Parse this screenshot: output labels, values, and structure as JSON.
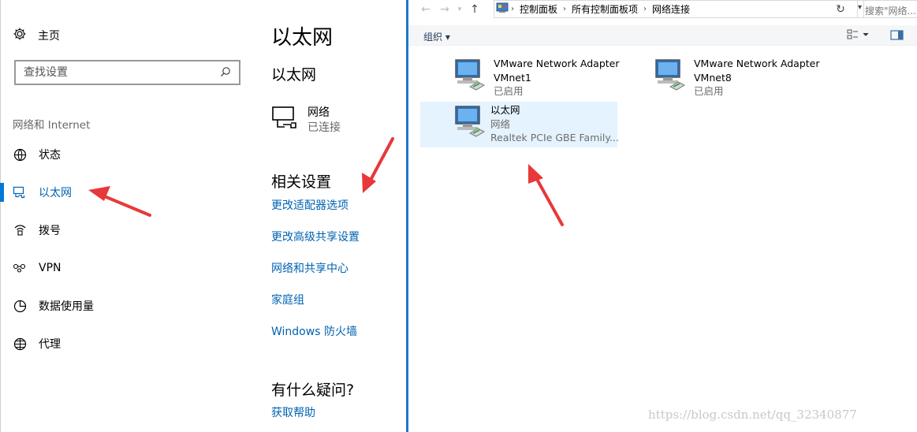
{
  "settings": {
    "home_label": "主页",
    "search_placeholder": "查找设置",
    "section_title": "网络和 Internet",
    "nav": [
      {
        "label": "状态",
        "icon": "globe-status-icon"
      },
      {
        "label": "以太网",
        "icon": "ethernet-icon",
        "active": true
      },
      {
        "label": "拨号",
        "icon": "dialup-icon"
      },
      {
        "label": "VPN",
        "icon": "vpn-icon"
      },
      {
        "label": "数据使用量",
        "icon": "data-usage-icon"
      },
      {
        "label": "代理",
        "icon": "proxy-globe-icon"
      }
    ],
    "content": {
      "title": "以太网",
      "subtitle": "以太网",
      "network_name": "网络",
      "network_status": "已连接",
      "related_title": "相关设置",
      "links": [
        "更改适配器选项",
        "更改高级共享设置",
        "网络和共享中心",
        "家庭组",
        "Windows 防火墙"
      ],
      "question_title": "有什么疑问?",
      "help_link": "获取帮助"
    }
  },
  "explorer": {
    "breadcrumb": [
      "控制面板",
      "所有控制面板项",
      "网络连接"
    ],
    "search_placeholder": "搜索\"网络...",
    "organize_label": "组织 ▾",
    "adapters": [
      {
        "name": "VMware Network Adapter",
        "line2": "VMnet1",
        "line3": "已启用"
      },
      {
        "name": "VMware Network Adapter",
        "line2": "VMnet8",
        "line3": "已启用"
      },
      {
        "name": "以太网",
        "line2": "网络",
        "line3": "Realtek PCIe GBE Family...",
        "selected": true
      }
    ]
  },
  "watermark": "https://blog.csdn.net/qq_32340877",
  "colors": {
    "accent": "#0078d7",
    "link": "#0063b1",
    "divider": "#1979ca",
    "annotation": "#e8383a"
  }
}
